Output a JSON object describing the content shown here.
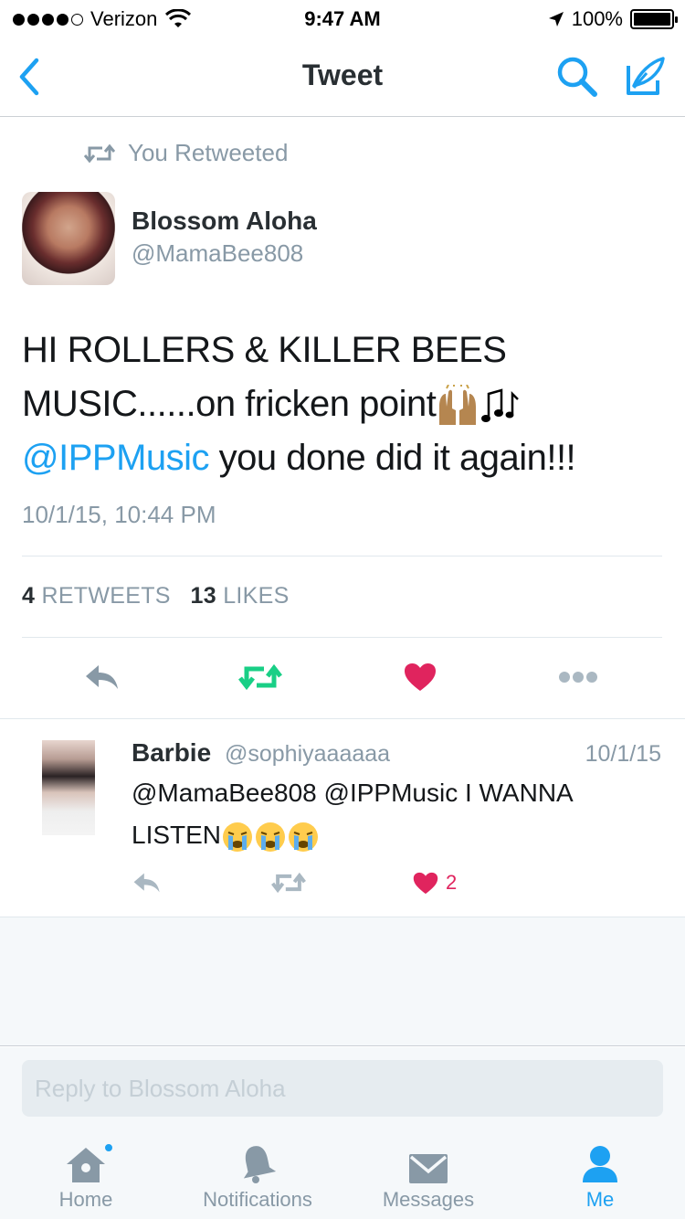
{
  "status_bar": {
    "carrier": "Verizon",
    "time": "9:47 AM",
    "battery": "100%"
  },
  "nav": {
    "title": "Tweet",
    "back_icon": "chevron-left-icon",
    "search_icon": "search-icon",
    "compose_icon": "compose-icon"
  },
  "retweet_context": "You Retweeted",
  "tweet": {
    "author_name": "Blossom Aloha",
    "author_handle": "@MamaBee808",
    "text_line1": "HI ROLLERS & KILLER BEES",
    "text_line2": "MUSIC......on fricken point",
    "mention": "@IPPMusic",
    "text_line3_rest": " you done did it again!!!",
    "timestamp": "10/1/15, 10:44 PM",
    "retweets_count": "4",
    "retweets_label": "RETWEETS",
    "likes_count": "13",
    "likes_label": "LIKES"
  },
  "reply": {
    "name": "Barbie",
    "handle": "@sophiyaaaaaa",
    "date": "10/1/15",
    "text_line1": "@MamaBee808 @IPPMusic I WANNA",
    "text_line2": "LISTEN",
    "like_count": "2"
  },
  "reply_box": {
    "placeholder": "Reply to Blossom Aloha"
  },
  "tabs": [
    {
      "label": "Home"
    },
    {
      "label": "Notifications"
    },
    {
      "label": "Messages"
    },
    {
      "label": "Me"
    }
  ],
  "colors": {
    "accent": "#1da1f2",
    "retweet": "#19cf86",
    "like": "#e0245e",
    "muted": "#8899a6"
  }
}
